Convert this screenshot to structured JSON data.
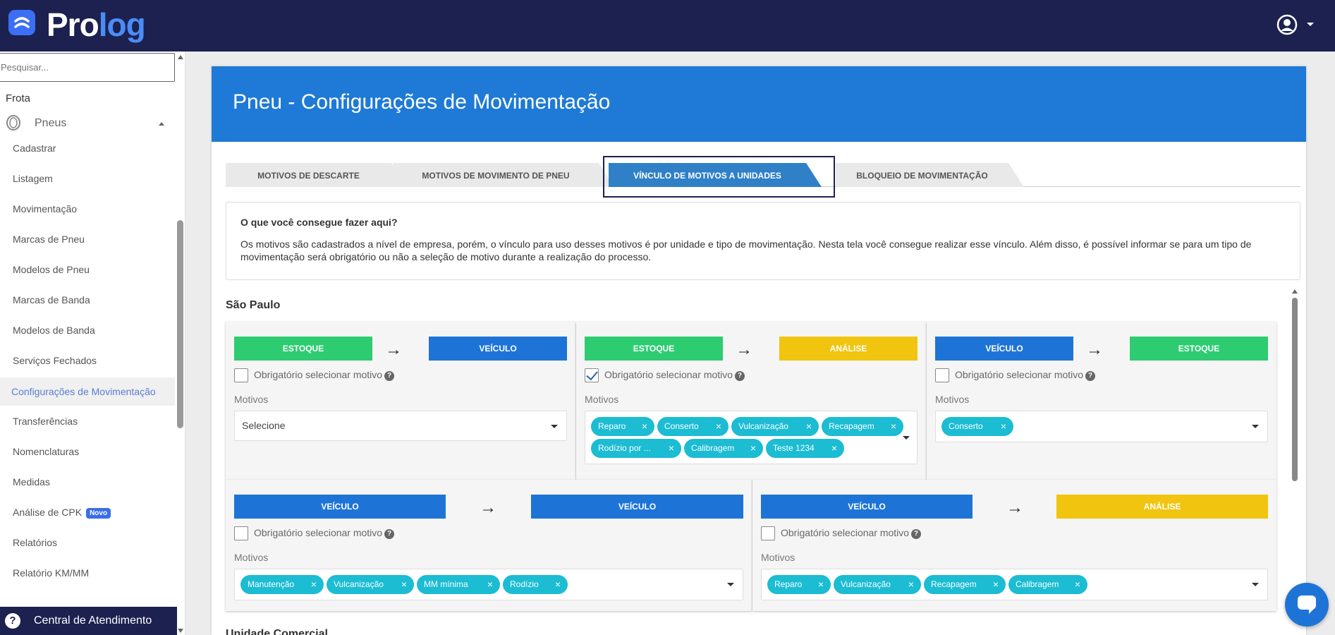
{
  "app": {
    "logo_main": "Pro",
    "logo_accent": "log",
    "brand_color": "#1d2150",
    "accent_color": "#1e7ad6"
  },
  "header": {
    "user_icon": "user-circle-icon"
  },
  "sidebar": {
    "search_placeholder": "Pesquisar...",
    "frota": "Frota",
    "pneus": "Pneus",
    "items": [
      {
        "label": "Cadastrar"
      },
      {
        "label": "Listagem"
      },
      {
        "label": "Movimentação"
      },
      {
        "label": "Marcas de Pneu"
      },
      {
        "label": "Modelos de Pneu"
      },
      {
        "label": "Marcas de Banda"
      },
      {
        "label": "Modelos de Banda"
      },
      {
        "label": "Serviços Fechados"
      },
      {
        "label": "Configurações de Movimentação",
        "active": true
      },
      {
        "label": "Transferências"
      },
      {
        "label": "Nomenclaturas"
      },
      {
        "label": "Medidas"
      },
      {
        "label": "Análise de CPK",
        "badge": "Novo"
      },
      {
        "label": "Relatórios"
      },
      {
        "label": "Relatório KM/MM"
      }
    ],
    "central": "Central de Atendimento"
  },
  "page": {
    "title": "Pneu - Configurações de Movimentação",
    "tabs": [
      {
        "label": "MOTIVOS DE DESCARTE"
      },
      {
        "label": "MOTIVOS DE MOVIMENTO DE PNEU"
      },
      {
        "label": "VÍNCULO DE MOTIVOS A UNIDADES",
        "active": true
      },
      {
        "label": "BLOQUEIO DE MOVIMENTAÇÃO"
      }
    ],
    "info": {
      "title": "O que você consegue fazer aqui?",
      "text": "Os motivos são cadastrados a nível de empresa, porém, o vínculo para uso desses motivos é por unidade e tipo de movimentação. Nesta tela você consegue realizar esse vínculo. Além disso, é possível informar se para um tipo de movimentação será obrigatório ou não a seleção de motivo durante a realização do processo."
    },
    "unit_1": "São Paulo",
    "unit_2": "Unidade Comercial",
    "check_label": "Obrigatório selecionar motivo",
    "motivos_label": "Motivos",
    "arrow": "→",
    "cards": [
      {
        "from": "ESTOQUE",
        "to": "VEÍCULO",
        "checked": false,
        "placeholder": "Selecione",
        "chips": []
      },
      {
        "from": "ESTOQUE",
        "to": "ANÁLISE",
        "checked": true,
        "chips": [
          "Reparo",
          "Conserto",
          "Vulcanização",
          "Recapagem",
          "Rodízio por ...",
          "Calibragem",
          "Teste 1234"
        ]
      },
      {
        "from": "VEÍCULO",
        "to": "ESTOQUE",
        "checked": false,
        "chips": [
          "Conserto"
        ]
      },
      {
        "from": "VEÍCULO",
        "to": "VEÍCULO",
        "checked": false,
        "chips": [
          "Manutenção",
          "Vulcanização",
          "MM mínima",
          "Rodízio"
        ]
      },
      {
        "from": "VEÍCULO",
        "to": "ANÁLISE",
        "checked": false,
        "chips": [
          "Reparo",
          "Vulcanização",
          "Recapagem",
          "Calibragem"
        ]
      }
    ],
    "chip_remove": "×",
    "help": "?"
  },
  "colors": {
    "estoque": "#2ecc71",
    "veiculo": "#1e74d6",
    "analise": "#f1c40f",
    "chip": "#1cbcd3"
  }
}
